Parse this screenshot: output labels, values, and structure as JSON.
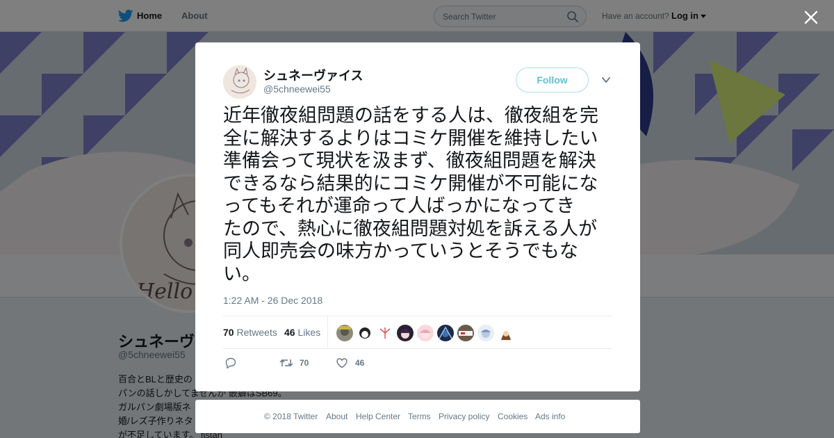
{
  "nav": {
    "home": "Home",
    "about": "About",
    "search_placeholder": "Search Twitter",
    "account_prompt": "Have an account?",
    "login": "Log in"
  },
  "background_profile": {
    "name": "シュネーヴ",
    "handle": "@5chneewei55",
    "bio_lines": [
      "百合とBLと歴史の",
      "パンの話しかしてませんが 嵌癖はSB69。",
      "ガルパン劇場版ネ",
      "婚/レズ子作りネタ",
      "が不足しています。 fistan"
    ]
  },
  "tweet": {
    "display_name": "シュネーヴァイス",
    "handle": "@5chneewei55",
    "follow_label": "Follow",
    "text_lines": [
      "近年徹夜組問題の話をする人は、徹夜組を完",
      "全に解決するよりはコミケ開催を維持したい",
      "準備会って現状を汲まず、徹夜組問題を解決",
      "できるなら結果的にコミケ開催が不可能にな",
      "ってもそれが運命って人ばっかになってき",
      "たので、熱心に徹夜組問題対処を訴える人が",
      "同人即売会の味方かっていうとそうでもな",
      "い。"
    ],
    "timestamp": "1:22 AM - 26 Dec 2018",
    "retweets_count": "70",
    "retweets_label": "Retweets",
    "likes_count": "46",
    "likes_label": "Likes",
    "action_retweets": "70",
    "action_likes": "46"
  },
  "footer": {
    "copyright": "© 2018 Twitter",
    "about": "About",
    "help": "Help Center",
    "terms": "Terms",
    "privacy": "Privacy policy",
    "cookies": "Cookies",
    "ads": "Ads info"
  },
  "colors": {
    "twitter_blue": "#1da1f2",
    "follow_text": "#58c4d0",
    "muted": "#657786"
  },
  "icons": [
    "twitter-bird-icon",
    "search-icon",
    "close-icon",
    "chevron-down-icon",
    "reply-icon",
    "retweet-icon",
    "heart-icon"
  ]
}
